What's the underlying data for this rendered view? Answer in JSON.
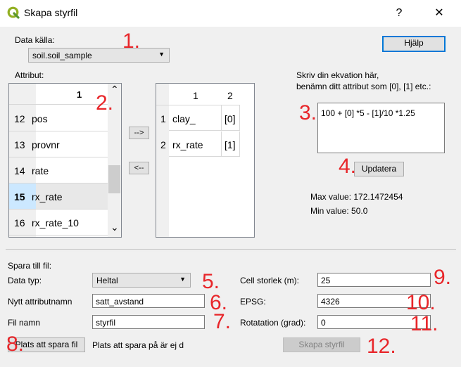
{
  "window": {
    "title": "Skapa styrfil",
    "help_glyph": "?",
    "close_glyph": "✕"
  },
  "data_source": {
    "label": "Data källa:",
    "value": "soil.soil_sample"
  },
  "help_button": "Hjälp",
  "attribute_list": {
    "label": "Attribut:",
    "column_header": "1",
    "rows": [
      {
        "num": "12",
        "name": "pos"
      },
      {
        "num": "13",
        "name": "provnr"
      },
      {
        "num": "14",
        "name": "rate"
      },
      {
        "num": "15",
        "name": "rx_rate"
      },
      {
        "num": "16",
        "name": "rx_rate_10"
      }
    ],
    "selected_row": "15"
  },
  "move_right": "-->",
  "move_left": "<--",
  "selected_table": {
    "headers": [
      "1",
      "2"
    ],
    "rows": [
      {
        "num": "1",
        "name": "clay_",
        "ref": "[0]"
      },
      {
        "num": "2",
        "name": "rx_rate",
        "ref": "[1]"
      }
    ]
  },
  "equation": {
    "instructions_line1": "Skriv din ekvation här,",
    "instructions_line2": "benämn ditt attribut som [0], [1] etc.:",
    "value": "100 + [0] *5 - [1]/10 *1.25"
  },
  "update_button": "Updatera",
  "stats": {
    "max": "Max value: 172.1472454",
    "min": "Min value: 50.0"
  },
  "save": {
    "section_label": "Spara till fil:",
    "data_type_label": "Data typ:",
    "data_type_value": "Heltal",
    "attr_name_label": "Nytt attributnamn",
    "attr_name_value": "satt_avstand",
    "file_name_label": "Fil namn",
    "file_name_value": "styrfil",
    "save_location_button": "Plats att spara fil",
    "save_location_status": "Plats att spara på är ej d",
    "cell_size_label": "Cell storlek (m):",
    "cell_size_value": "25",
    "epsg_label": "EPSG:",
    "epsg_value": "4326",
    "rotation_label": "Rotatation (grad):",
    "rotation_value": "0",
    "create_button": "Skapa styrfil"
  },
  "annotations": [
    "1.",
    "2.",
    "3.",
    "4.",
    "5.",
    "6.",
    "7.",
    "8.",
    "9.",
    "10.",
    "11.",
    "12."
  ],
  "colors": {
    "annotation_red": "#e8262a",
    "selection_blue": "#cce8ff",
    "qgis_green": "#93b023"
  },
  "icons": {
    "app_icon": "qgis-logo-icon",
    "combo_arrow": "▼",
    "scroll_up": "⌃",
    "scroll_down": "⌄"
  }
}
